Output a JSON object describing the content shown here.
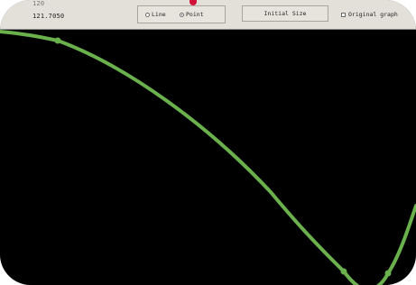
{
  "toolbar": {
    "coord_top": "120",
    "coord_value": "121.7050",
    "display_mode": {
      "options": [
        "Line",
        "Point"
      ],
      "selected": "Point"
    },
    "initial_size_label": "Initial Size",
    "original_graph_label": "Original graph",
    "original_graph_checked": false
  },
  "plot": {
    "background_color": "#000000",
    "curve_color": "#6ab04c"
  }
}
